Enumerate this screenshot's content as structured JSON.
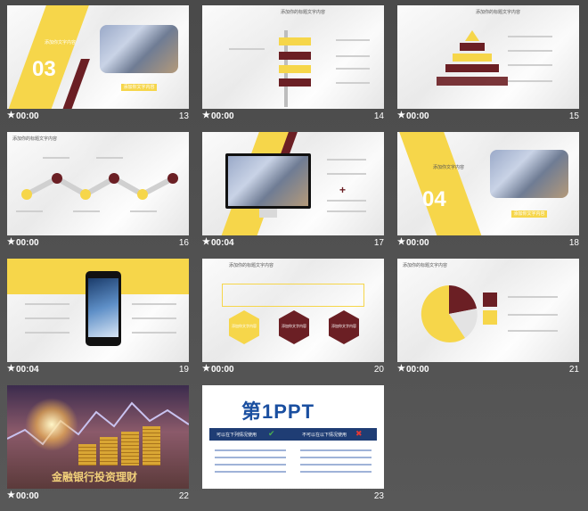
{
  "slides": [
    {
      "id": "s13",
      "number": "13",
      "time": "00:00",
      "big_number": "03",
      "label": "添加你文字内容",
      "button": "添加你文字内容"
    },
    {
      "id": "s14",
      "number": "14",
      "time": "00:00",
      "title": "添加你的标题文字内容"
    },
    {
      "id": "s15",
      "number": "15",
      "time": "00:00",
      "title": "添加你的标题文字内容"
    },
    {
      "id": "s16",
      "number": "16",
      "time": "00:00",
      "title": "添加你的标题文字内容"
    },
    {
      "id": "s17",
      "number": "17",
      "time": "00:04"
    },
    {
      "id": "s18",
      "number": "18",
      "time": "00:00",
      "big_number": "04",
      "label": "添加你文字内容",
      "button": "添加你文字内容"
    },
    {
      "id": "s19",
      "number": "19",
      "time": "00:04"
    },
    {
      "id": "s20",
      "number": "20",
      "time": "00:00",
      "title": "添加你的标题文字内容",
      "hex_labels": [
        "添加你文字内容",
        "添加你文字内容",
        "添加你文字内容"
      ]
    },
    {
      "id": "s21",
      "number": "21",
      "time": "00:00",
      "title": "添加你的标题文字内容"
    },
    {
      "id": "s22",
      "number": "22",
      "time": "00:00",
      "heading": "金融银行投资理财"
    },
    {
      "id": "s23",
      "number": "23",
      "time": "",
      "logo_text": "第1PPT",
      "bar_left": "可以在下列情况使用",
      "bar_right": "不可以在以下情况使用"
    }
  ],
  "colors": {
    "accent": "#f6d64a",
    "secondary": "#6b1f24",
    "background": "#555555"
  }
}
